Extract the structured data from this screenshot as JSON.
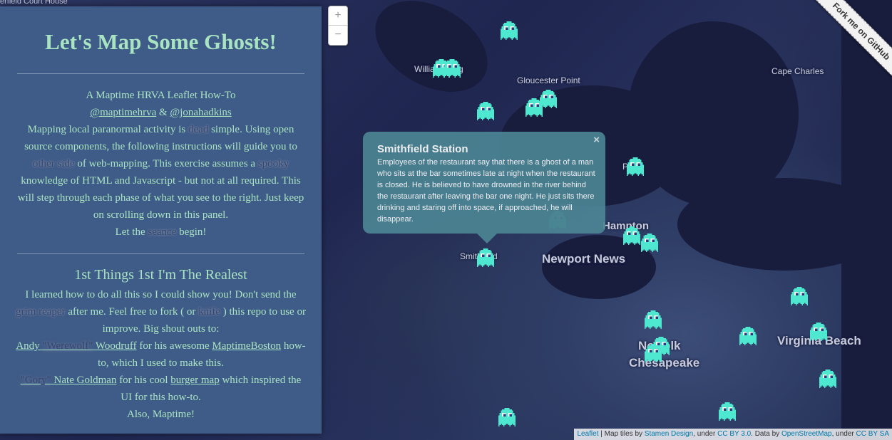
{
  "map": {
    "top_left_label": "erfield Court House",
    "places": [
      {
        "key": "williamsburg",
        "text": "Williamsburg"
      },
      {
        "key": "gloucester",
        "text": "Gloucester Point"
      },
      {
        "key": "capecharles",
        "text": "Cape Charles"
      },
      {
        "key": "poquoson",
        "text": "Poq"
      },
      {
        "key": "hampton",
        "text": "Hampton"
      },
      {
        "key": "newportnews",
        "text": "Newport News"
      },
      {
        "key": "smithfield",
        "text": "Smithfield"
      },
      {
        "key": "norfolk",
        "text": "Norfolk"
      },
      {
        "key": "chesapeake",
        "text": "Chesapeake"
      },
      {
        "key": "virginiabeach",
        "text": "Virginia Beach"
      }
    ],
    "zoom_in": "+",
    "zoom_out": "−",
    "ribbon": "Fork me on GitHub",
    "popup": {
      "title": "Smithfield Station",
      "close": "×",
      "body": "Employees of the restaurant say that there is a ghost of a man who sits at the bar sometimes late at night when the restaurant is closed. He is believed to have drowned in the river behind the restaurant after leaving the bar one night. He just sits there drinking and staring off into space, if approached, he will disappear."
    },
    "attribution": {
      "leaflet": "Leaflet",
      "t1": " | Map tiles by ",
      "stamen": "Stamen Design",
      "t2": ", under ",
      "ccby": "CC BY 3.0",
      "t3": ". Data by ",
      "osm": "OpenStreetMap",
      "t4": ", under ",
      "ccbysa": "CC BY SA"
    },
    "ghost_color": "#4de8cf",
    "ghost_icon": "ghost-icon"
  },
  "panel": {
    "title": "Let's Map Some Ghosts!",
    "subtitle": "A Maptime HRVA Leaflet How-To",
    "handle1": "@maptimehrva",
    "amp": " & ",
    "handle2": "@jonahadkins",
    "p1a": "Mapping local paranormal activity is ",
    "w_dead": "dead",
    "p1b": " simple. Using open source components, the following instructions will guide you to ",
    "w_other": "other side",
    "p1c": " of web-mapping. This exercise assumes a ",
    "w_spooky": "spooky",
    "p1d": " knowledge of HTML and Javascript - but not at all required. This will step through each phase of what you see to the right. Just keep on scrolling down in this panel.",
    "p2a": "Let the ",
    "w_seance": "seance",
    "p2b": " begin!",
    "h2": "1st Things 1st I'm The Realest",
    "s1a": "I learned how to do all this so I could show you! Don't send the ",
    "w_grim": "grim reaper",
    "s1b": " after me. Feel free to fork ( or ",
    "w_knife": "knife",
    "s1c": " ) this repo to use or improve. Big shout outs to:",
    "andy": "Andy ",
    "werewolf": "\"Werewolf\"",
    "woodruff": " Woodruff",
    "s2a": " for his awesome ",
    "maptimeboston": "MaptimeBoston",
    "s2b": " how-to, which I used to make this.",
    "gory": "\"Gory\"",
    "nate": " Nate Goldman",
    "s3a": " for his cool ",
    "burger": "burger map",
    "s3b": " which inspired the UI for this how-to.",
    "s4": "Also, Maptime!"
  }
}
